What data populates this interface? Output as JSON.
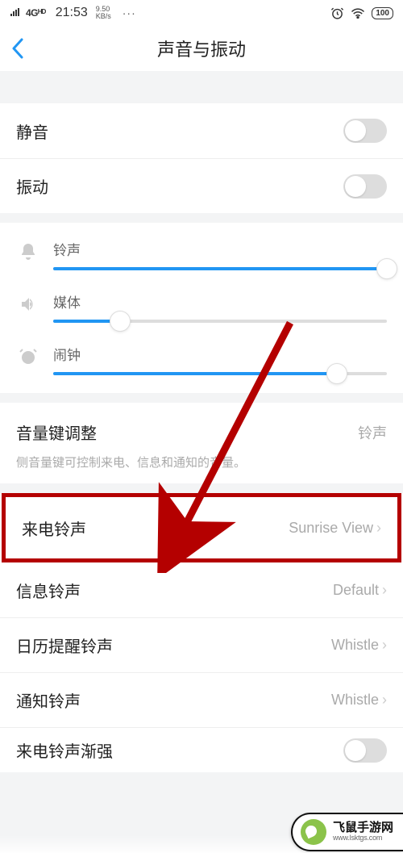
{
  "status_bar": {
    "signal": "4Gᴴᴰ",
    "time": "21:53",
    "data_rate_top": "9.50",
    "data_rate_bottom": "KB/s",
    "dots": "···",
    "battery": "100"
  },
  "header": {
    "title": "声音与振动"
  },
  "toggles": {
    "mute": {
      "label": "静音",
      "on": false
    },
    "vibrate": {
      "label": "振动",
      "on": false
    }
  },
  "sliders": {
    "ringtone": {
      "label": "铃声",
      "percent": 100
    },
    "media": {
      "label": "媒体",
      "percent": 20
    },
    "alarm": {
      "label": "闹钟",
      "percent": 85
    }
  },
  "volume_key": {
    "label": "音量键调整",
    "value": "铃声",
    "note": "侧音量键可控制来电、信息和通知的音量。"
  },
  "ringtones": {
    "incoming": {
      "label": "来电铃声",
      "value": "Sunrise View"
    },
    "message": {
      "label": "信息铃声",
      "value": "Default"
    },
    "calendar": {
      "label": "日历提醒铃声",
      "value": "Whistle"
    },
    "notify": {
      "label": "通知铃声",
      "value": "Whistle"
    },
    "ascending": {
      "label": "来电铃声渐强"
    }
  },
  "watermark": {
    "name": "飞鼠手游网",
    "url": "www.lsktgs.com"
  }
}
